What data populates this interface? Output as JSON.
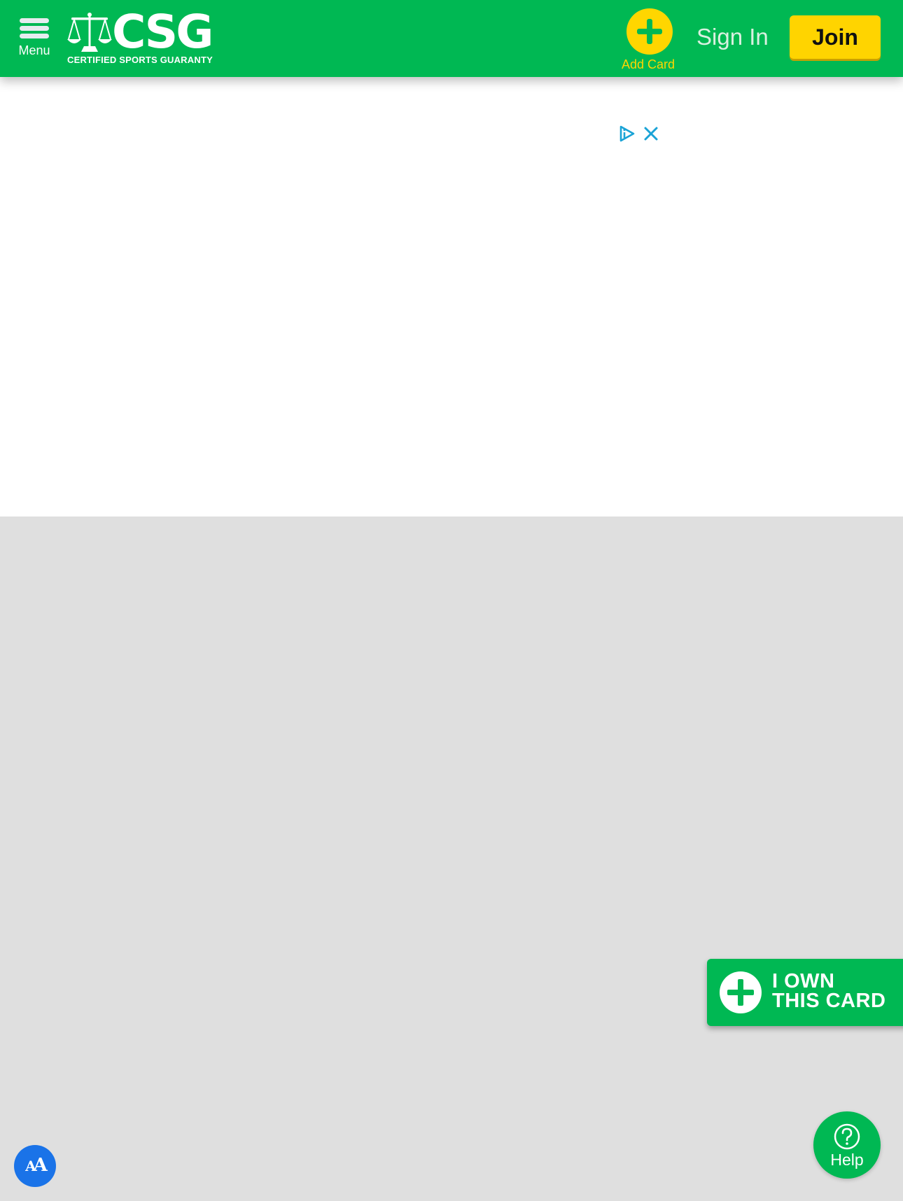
{
  "header": {
    "menu_label": "Menu",
    "logo_text": "CSG",
    "logo_trademark": "™",
    "logo_tagline": "CERTIFIED SPORTS GUARANTY",
    "add_card_label": "Add Card",
    "sign_in_label": "Sign In",
    "join_label": "Join"
  },
  "floating": {
    "own_card_line1": "I OWN",
    "own_card_line2": "THIS CARD",
    "help_label": "Help",
    "accessibility_glyph_big": "A",
    "accessibility_glyph_small": "A"
  },
  "icons": {
    "menu": "hamburger-icon",
    "logo": "scales-of-justice-icon",
    "add_card": "plus-icon",
    "ad_choices": "adchoices-icon",
    "ad_close": "close-icon",
    "own_card": "plus-icon",
    "help": "question-mark-icon",
    "accessibility": "text-size-icon"
  },
  "colors": {
    "brand_green": "#00b853",
    "accent_yellow": "#ffd600",
    "ad_icon_blue": "#1aa3d6",
    "accessibility_blue": "#1a73e8",
    "page_background": "#dfdfdf"
  }
}
